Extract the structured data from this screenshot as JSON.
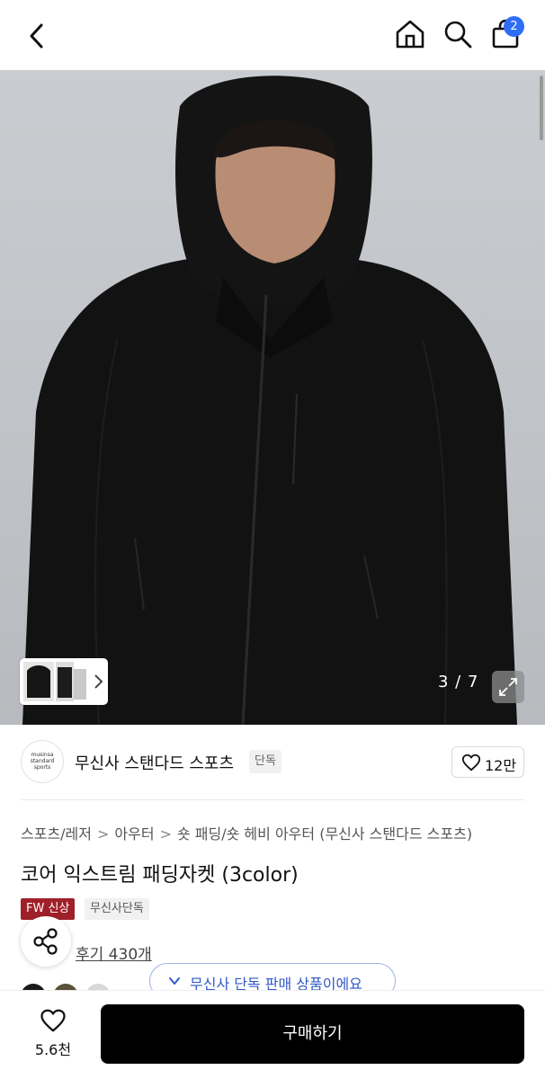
{
  "header": {
    "cart_count": "2"
  },
  "gallery": {
    "page_indicator": "3 / 7",
    "current_index": 3,
    "total_images": 7
  },
  "brand": {
    "logo_text": [
      "musinsa",
      "standard",
      "sports"
    ],
    "name": "무신사 스탠다드 스포츠",
    "exclusive_label": "단독",
    "like_count": "12만"
  },
  "product": {
    "breadcrumb": [
      "스포츠/레저",
      "아우터",
      "숏 패딩/숏 헤비 아우터 (무신사 스탠다드 스포츠)"
    ],
    "title": "코어 익스트림 패딩자켓 (3color)",
    "tags": [
      "FW 신상",
      "무신사단독"
    ],
    "reviews": "후기 430개",
    "exclusive_toast": "무신사 단독 판매 상품이에요"
  },
  "colors": {
    "swatches": [
      "#1a1a1a",
      "#5a5236",
      "#d8d8d8"
    ],
    "brand_red": "#a0202a",
    "badge_blue": "#2f6df6",
    "toast_blue": "#3058c8"
  },
  "bottom_bar": {
    "wish_count": "5.6천",
    "buy_label": "구매하기"
  },
  "icons": [
    "back-arrow-icon",
    "home-icon",
    "search-icon",
    "shopping-bag-icon",
    "chevron-right-icon",
    "expand-icon",
    "heart-icon",
    "share-icon",
    "check-icon"
  ]
}
